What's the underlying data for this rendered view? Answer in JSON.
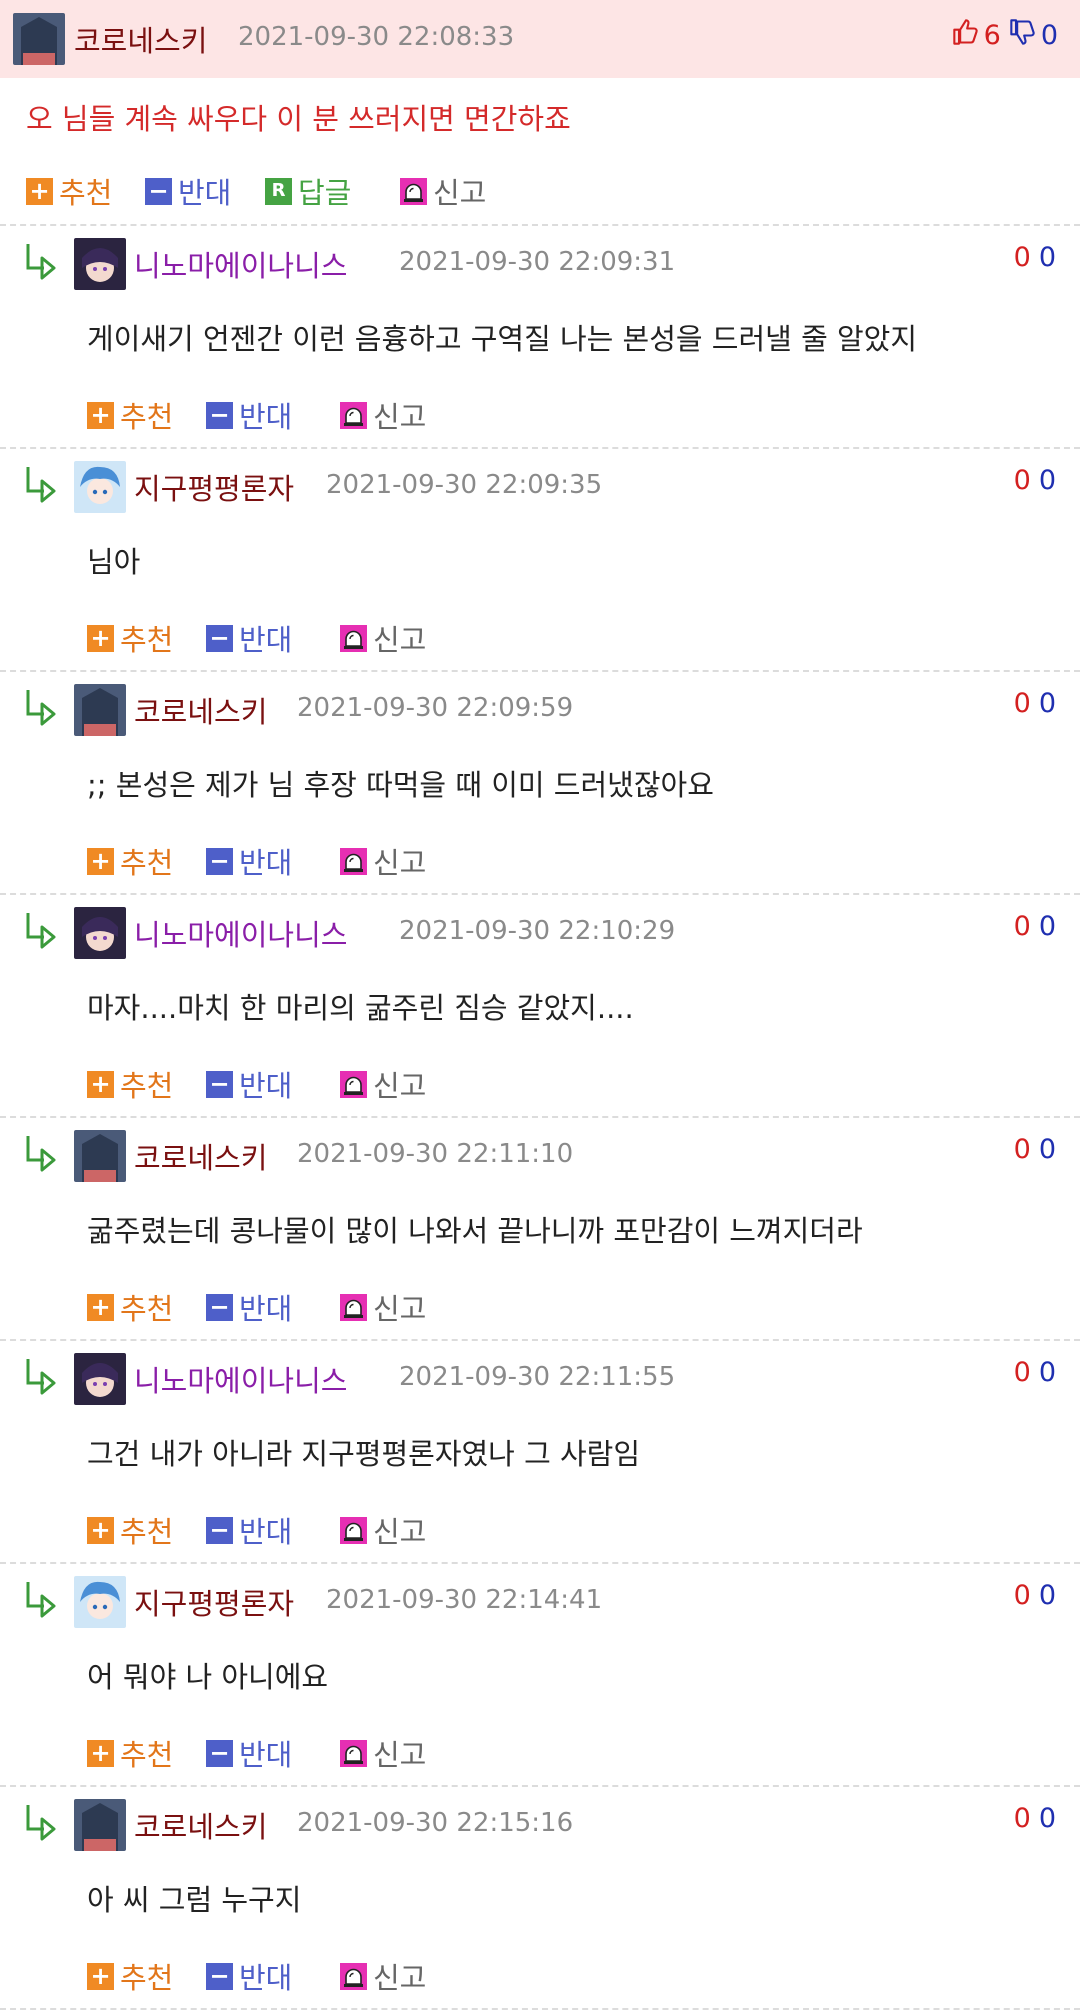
{
  "top_comment": {
    "nickname": "코로네스키",
    "timestamp": "2021-09-30 22:08:33",
    "upvotes": "6",
    "downvotes": "0",
    "text": "오 님들 계속 싸우다 이 분 쓰러지면 면간하죠"
  },
  "actions": {
    "recommend": "추천",
    "oppose": "반대",
    "reply": "답글",
    "report": "신고",
    "reply_badge": "R"
  },
  "replies": [
    {
      "nickname": "니노마에이나니스",
      "timestamp": "2021-09-30 22:09:31",
      "upvotes": "0",
      "downvotes": "0",
      "text": "게이새기 언젠간 이런 음흉하고 구역질 나는 본성을 드러낼 줄 알았지"
    },
    {
      "nickname": "지구평평론자",
      "timestamp": "2021-09-30 22:09:35",
      "upvotes": "0",
      "downvotes": "0",
      "text": "님아"
    },
    {
      "nickname": "코로네스키",
      "timestamp": "2021-09-30 22:09:59",
      "upvotes": "0",
      "downvotes": "0",
      "text": ";; 본성은 제가 님 후장 따먹을 때 이미 드러냈잖아요"
    },
    {
      "nickname": "니노마에이나니스",
      "timestamp": "2021-09-30 22:10:29",
      "upvotes": "0",
      "downvotes": "0",
      "text": "마자....마치 한 마리의 굶주린 짐승 같았지...."
    },
    {
      "nickname": "코로네스키",
      "timestamp": "2021-09-30 22:11:10",
      "upvotes": "0",
      "downvotes": "0",
      "text": "굶주렸는데 콩나물이 많이 나와서 끝나니까 포만감이 느껴지더라"
    },
    {
      "nickname": "니노마에이나니스",
      "timestamp": "2021-09-30 22:11:55",
      "upvotes": "0",
      "downvotes": "0",
      "text": "그건 내가 아니라 지구평평론자였나 그 사람임"
    },
    {
      "nickname": "지구평평론자",
      "timestamp": "2021-09-30 22:14:41",
      "upvotes": "0",
      "downvotes": "0",
      "text": "어 뭐야 나 아니에요"
    },
    {
      "nickname": "코로네스키",
      "timestamp": "2021-09-30 22:15:16",
      "upvotes": "0",
      "downvotes": "0",
      "text": "아 씨 그럼 누구지"
    }
  ],
  "colors": {
    "header_bg": "#fde5e5",
    "top_text": "#d42a2a",
    "recommend": "#f08a24",
    "oppose": "#4e5fc9",
    "reply": "#45a343",
    "report": "#e62fb3",
    "nick_purple": "#8a1ea8",
    "nick_maroon": "#7a1010"
  },
  "icons": {
    "upvote": "thumbs-up-icon",
    "downvote": "thumbs-down-icon",
    "reply_arrow": "reply-arrow-icon",
    "report": "siren-icon"
  }
}
